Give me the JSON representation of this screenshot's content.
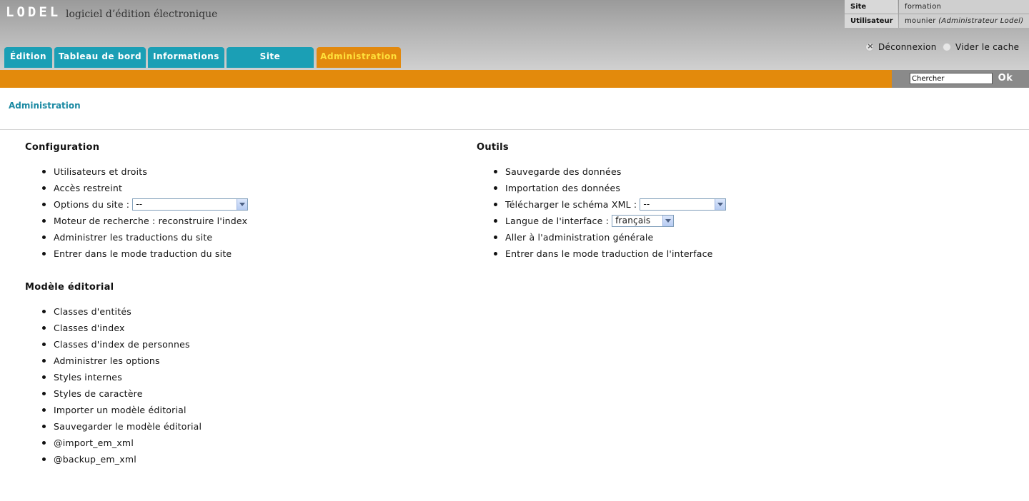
{
  "header": {
    "logo": "LODEL",
    "tagline": "logiciel d’édition électronique"
  },
  "info": {
    "site_label": "Site",
    "site_value": "formation",
    "user_label": "Utilisateur",
    "user_name": "mounier",
    "user_role": "(Administrateur Lodel)"
  },
  "tabs": [
    {
      "label": "Édition"
    },
    {
      "label": "Tableau de bord"
    },
    {
      "label": "Informations"
    },
    {
      "label": "Site"
    },
    {
      "label": "Administration"
    }
  ],
  "header_links": {
    "logout": "Déconnexion",
    "cache": "Vider le cache"
  },
  "search": {
    "value": "Chercher",
    "button": "Ok"
  },
  "page_title": "Administration",
  "configuration": {
    "title": "Configuration",
    "items": [
      "Utilisateurs et droits",
      "Accès restreint",
      "Options du site :",
      "Moteur de recherche : reconstruire l'index",
      "Administrer les traductions du site",
      "Entrer dans le mode traduction du site"
    ],
    "options_select": "--"
  },
  "modele": {
    "title": "Modèle éditorial",
    "items": [
      "Classes d'entités",
      "Classes d'index",
      "Classes d'index de personnes",
      "Administrer les options",
      "Styles internes",
      "Styles de caractère",
      "Importer un modèle éditorial",
      "Sauvegarder le modèle éditorial",
      "@import_em_xml",
      "@backup_em_xml"
    ]
  },
  "outils": {
    "title": "Outils",
    "items": [
      "Sauvegarde des données",
      "Importation des données",
      "Télécharger le schéma XML :",
      "Langue de l'interface :",
      "Aller à l'administration générale",
      "Entrer dans le mode traduction de l'interface"
    ],
    "schema_select": "--",
    "langue_select": "français"
  },
  "colors": {
    "tab": "#1b9fb5",
    "tab_active": "#e2890e",
    "tab_active_text": "#ffe03a",
    "orange_bar": "#e38a0c",
    "link": "#1b8aa3"
  }
}
